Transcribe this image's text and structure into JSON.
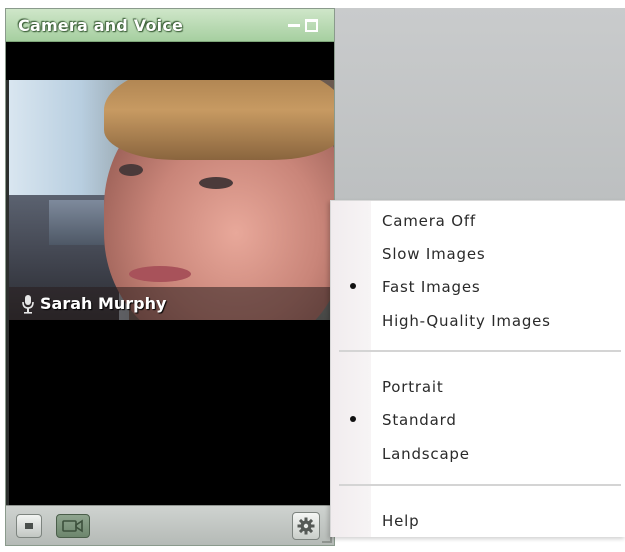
{
  "window": {
    "title": "Camera and Voice"
  },
  "video": {
    "participant_name": "Sarah Murphy"
  },
  "icons": {
    "minimize": "minimize-icon",
    "maximize": "maximize-icon",
    "microphone": "microphone-icon",
    "stop": "stop-icon",
    "camera": "video-camera-icon",
    "settings": "gear-icon"
  },
  "menu": {
    "items": [
      {
        "label": "Camera Off",
        "selected": false
      },
      {
        "label": "Slow Images",
        "selected": false
      },
      {
        "label": "Fast Images",
        "selected": true
      },
      {
        "label": "High-Quality Images",
        "selected": false
      },
      {
        "label": "Portrait",
        "selected": false
      },
      {
        "label": "Standard",
        "selected": true
      },
      {
        "label": "Landscape",
        "selected": false
      },
      {
        "label": "Help",
        "selected": false
      }
    ]
  },
  "colors": {
    "titlebar": "#b4d8ae",
    "camera_button_active": "#7d967d",
    "menu_gutter": "#f3eff0"
  }
}
